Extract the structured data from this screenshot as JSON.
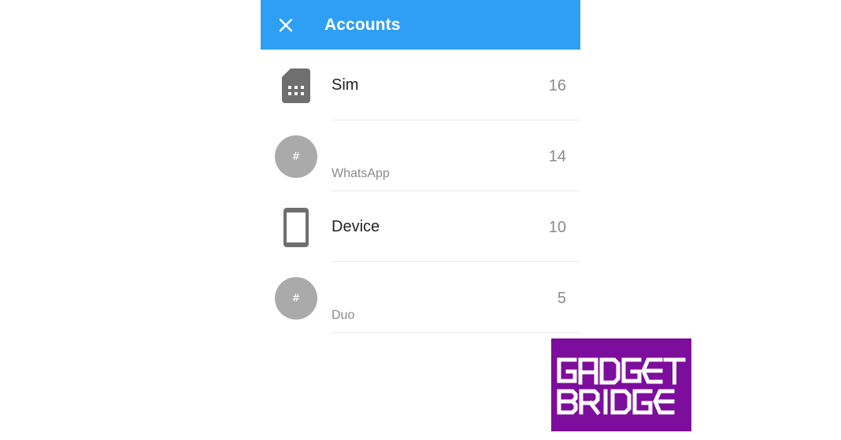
{
  "header": {
    "title": "Accounts",
    "close_icon": "close-icon"
  },
  "accounts": [
    {
      "name": "Sim",
      "subtitle": "",
      "count": "16",
      "icon": "sim-card-icon"
    },
    {
      "name": "",
      "subtitle": "WhatsApp",
      "count": "14",
      "icon": "hash-avatar-icon",
      "avatar_text": "#"
    },
    {
      "name": "Device",
      "subtitle": "",
      "count": "10",
      "icon": "phone-device-icon"
    },
    {
      "name": "",
      "subtitle": "Duo",
      "count": "5",
      "icon": "hash-avatar-icon",
      "avatar_text": "#"
    }
  ],
  "watermark": {
    "line1": "GADGET",
    "line2": "BRIDGE",
    "icon": "gadgetbridge-logo"
  },
  "colors": {
    "appbar": "#2f9ff5",
    "icon_gray": "#6f6f6f",
    "avatar_gray": "#aaaaaa",
    "logo_bg": "#7d0d9c"
  }
}
